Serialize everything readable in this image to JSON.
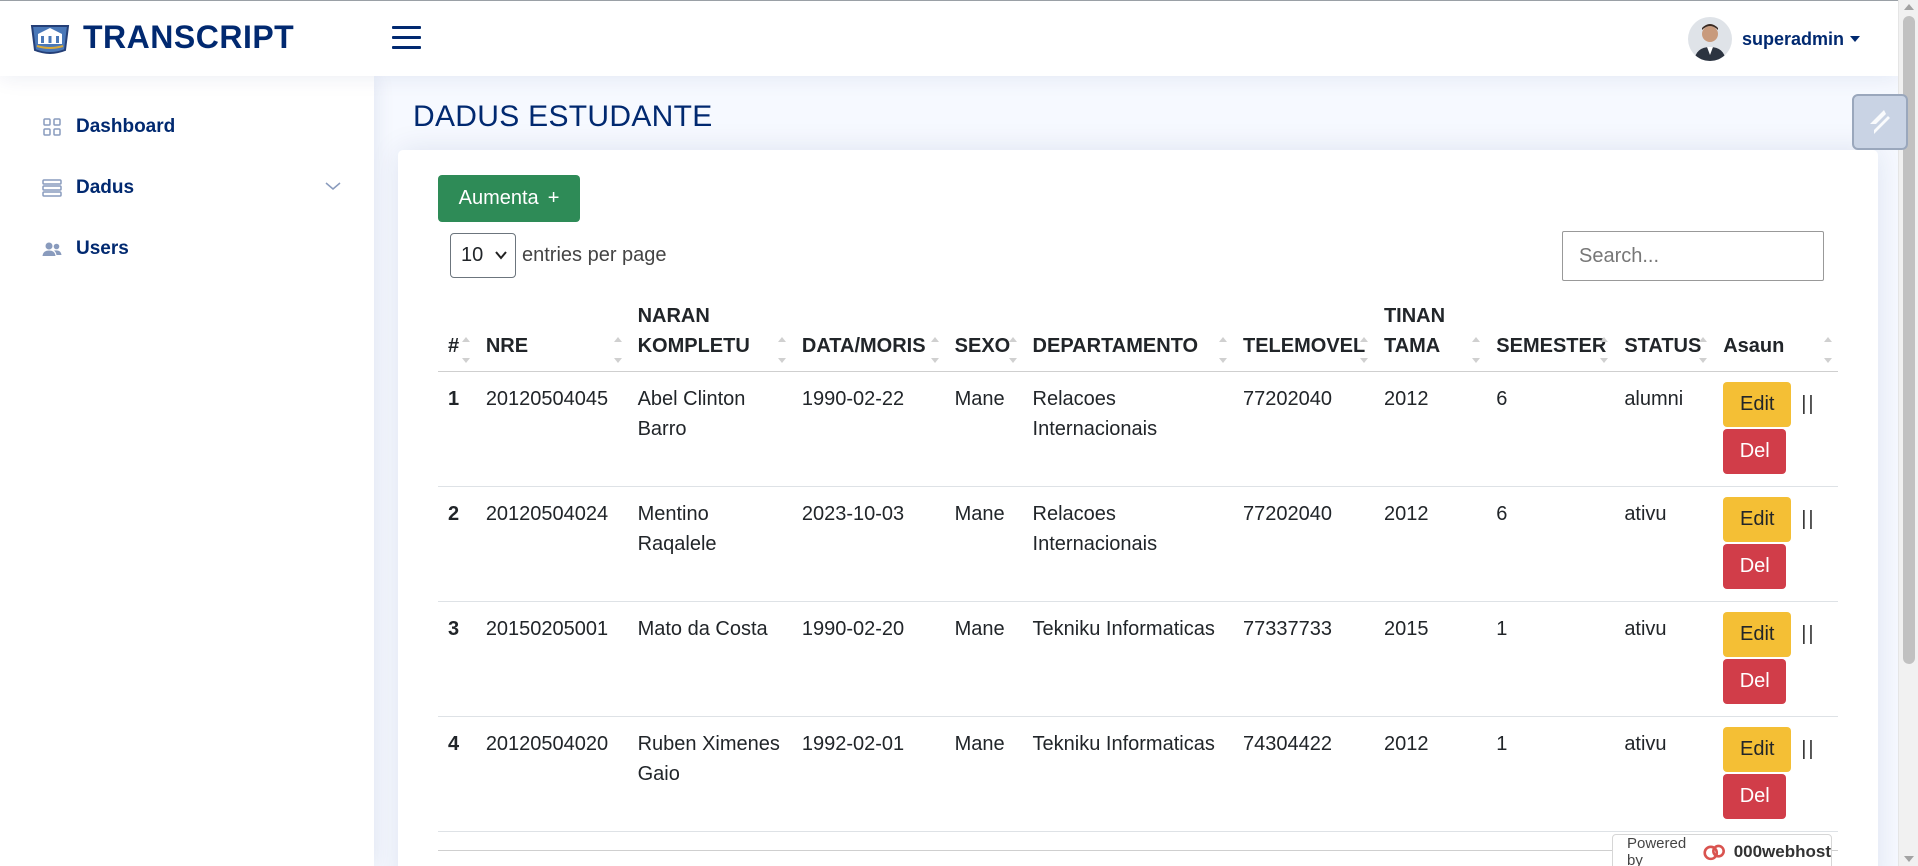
{
  "header": {
    "logo_text": "TRANSCRIPT",
    "user_name": "superadmin"
  },
  "sidebar": {
    "items": [
      {
        "label": "Dashboard",
        "icon": "grid-icon"
      },
      {
        "label": "Dadus",
        "icon": "server-icon"
      },
      {
        "label": "Users",
        "icon": "people-icon"
      }
    ]
  },
  "main": {
    "page_title": "DADUS ESTUDANTE",
    "add_button": "Aumenta",
    "add_button_icon": "+",
    "entries_value": "10",
    "entries_label": "entries per page",
    "search_placeholder": "Search..."
  },
  "table": {
    "columns": [
      "#",
      "NRE",
      "NARAN KOMPLETU",
      "DATA/MORIS",
      "SEXO",
      "DEPARTAMENTO",
      "TELEMOVEL",
      "TINAN TAMA",
      "SEMESTER",
      "STATUS",
      "Asaun"
    ],
    "rows": [
      {
        "num": "1",
        "nre": "20120504045",
        "naran": "Abel Clinton Barro",
        "data": "1990-02-22",
        "sexo": "Mane",
        "departamento": "Relacoes Internacionais",
        "telemovel": "77202040",
        "tinan": "2012",
        "semester": "6",
        "status": "alumni"
      },
      {
        "num": "2",
        "nre": "20120504024",
        "naran": "Mentino Raqalele",
        "data": "2023-10-03",
        "sexo": "Mane",
        "departamento": "Relacoes Internacionais",
        "telemovel": "77202040",
        "tinan": "2012",
        "semester": "6",
        "status": "ativu"
      },
      {
        "num": "3",
        "nre": "20150205001",
        "naran": "Mato da Costa",
        "data": "1990-02-20",
        "sexo": "Mane",
        "departamento": "Tekniku Informaticas",
        "telemovel": "77337733",
        "tinan": "2015",
        "semester": "1",
        "status": "ativu"
      },
      {
        "num": "4",
        "nre": "20120504020",
        "naran": "Ruben Ximenes Gaio",
        "data": "1992-02-01",
        "sexo": "Mane",
        "departamento": "Tekniku Informaticas",
        "telemovel": "74304422",
        "tinan": "2012",
        "semester": "1",
        "status": "ativu"
      }
    ],
    "edit_label": "Edit",
    "del_label": "Del",
    "separator": "||"
  },
  "footer": {
    "powered_by": "Powered by",
    "host": "000webhost"
  },
  "colors": {
    "brand": "#012970",
    "add_button": "#2e8b57",
    "edit_button": "#f4bf35",
    "del_button": "#d13d49",
    "background": "#f6f9ff"
  }
}
